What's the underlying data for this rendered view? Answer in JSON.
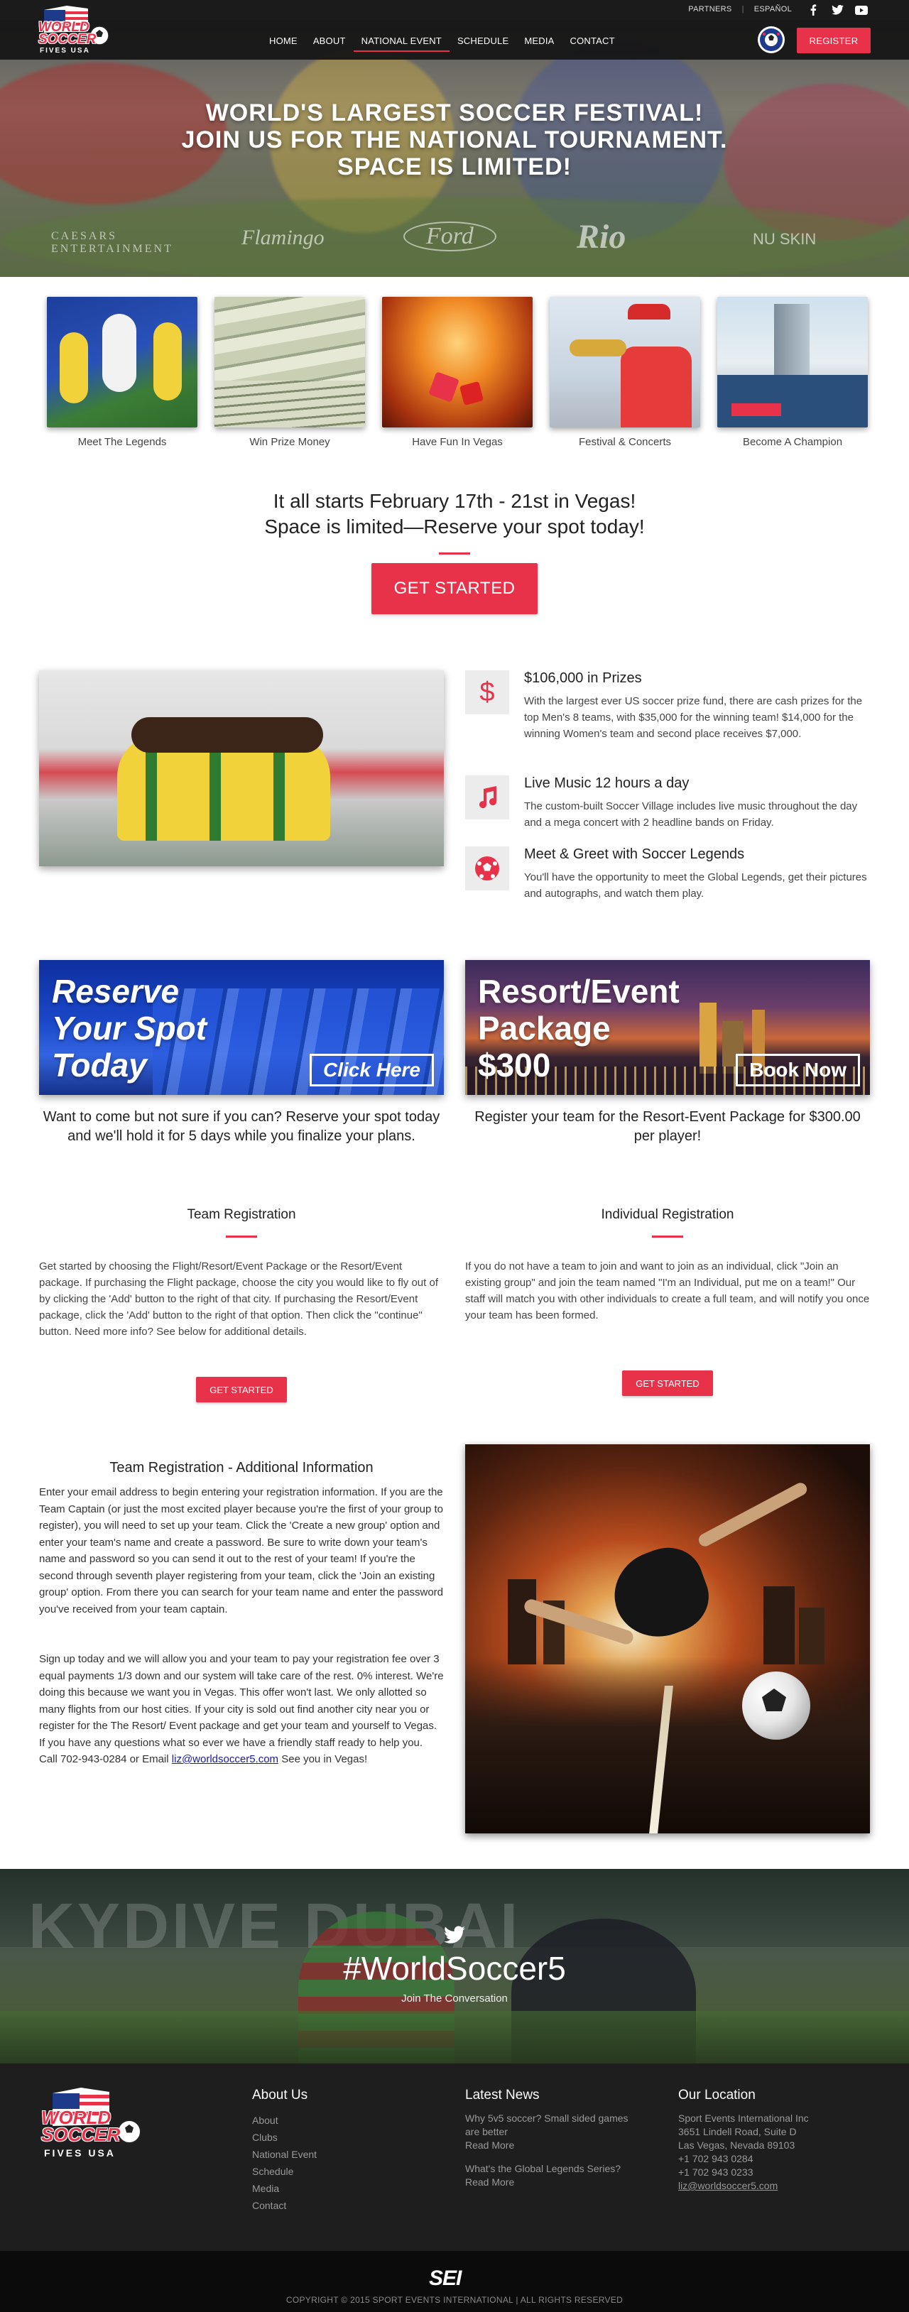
{
  "topbar": {
    "links": [
      "PARTNERS",
      "ESPAÑOL"
    ],
    "social": [
      "facebook-icon",
      "twitter-icon",
      "youtube-icon"
    ]
  },
  "header": {
    "logo_lines": [
      "WORLD",
      "SOCCER",
      "FIVES USA"
    ],
    "nav": [
      "HOME",
      "ABOUT",
      "NATIONAL EVENT",
      "SCHEDULE",
      "MEDIA",
      "CONTACT"
    ],
    "active_nav": "NATIONAL EVENT",
    "register_label": "REGISTER"
  },
  "hero": {
    "line1": "WORLD'S LARGEST SOCCER FESTIVAL!",
    "line2": "JOIN US FOR THE NATIONAL TOURNAMENT.",
    "line3": "SPACE IS LIMITED!",
    "sponsors": [
      "CAESARS ENTERTAINMENT",
      "Flamingo",
      "Ford",
      "Rio",
      "NU SKIN"
    ]
  },
  "features": [
    {
      "caption": "Meet The Legends"
    },
    {
      "caption": "Win Prize Money"
    },
    {
      "caption": "Have Fun In Vegas"
    },
    {
      "caption": "Festival & Concerts"
    },
    {
      "caption": "Become A Champion"
    }
  ],
  "cta": {
    "line1": "It all starts February 17th - 21st in Vegas!",
    "line2": "Space is limited—Reserve your spot today!",
    "button": "GET STARTED"
  },
  "info": [
    {
      "icon": "dollar-icon",
      "title": "$106,000 in Prizes",
      "text": "With the largest ever US soccer prize fund, there are cash prizes for the top Men's 8 teams, with $35,000 for the winning team! $14,000 for the winning Women's team and second place receives $7,000."
    },
    {
      "icon": "music-note-icon",
      "title": "Live Music 12 hours a day",
      "text": "The custom-built Soccer Village includes live music throughout the day and a mega concert with 2 headline bands on Friday."
    },
    {
      "icon": "soccer-ball-icon",
      "title": "Meet & Greet with Soccer Legends",
      "text": "You'll have the opportunity to meet the Global Legends, get their pictures and autographs, and watch them play."
    }
  ],
  "banners": {
    "left": {
      "title_lines": [
        "Reserve",
        "Your Spot",
        "Today"
      ],
      "button": "Click Here",
      "caption": "Want to come but not sure if you can? Reserve your spot today and we'll hold it for 5 days while you finalize your plans."
    },
    "right": {
      "title_lines": [
        "Resort/Event",
        "Package",
        "$300"
      ],
      "button": "Book Now",
      "caption": "Register your team for the Resort-Event Package for $300.00 per player!"
    }
  },
  "registration": {
    "team": {
      "title": "Team Registration",
      "text": "Get started by choosing the Flight/Resort/Event Package or the Resort/Event package. If purchasing the Flight package, choose the city you would like to fly out of by clicking the 'Add' button to the right of that city. If purchasing the Resort/Event package, click the 'Add' button to the right of that option. Then click the \"continue\" button. Need more info? See below for additional details.",
      "button": "GET STARTED"
    },
    "individual": {
      "title": "Individual Registration",
      "text": "If you do not have a team to join and want to join as an individual, click \"Join an existing group\" and join the team named \"I'm an Individual, put me on a team!\" Our staff will match you with other individuals to create a full team, and will notify you once your team has been formed.",
      "button": "GET STARTED"
    }
  },
  "additional": {
    "title": "Team Registration - Additional Information",
    "p1": "Enter your email address to begin entering your registration information. If you are the Team Captain (or just the most excited player because you're the first of your group to register), you will need to set up your team. Click the 'Create a new group' option and enter your team's name and create a password. Be sure to write down your team's name and password so you can send it out to the rest of your team! If you're the second through seventh player registering from your team, click the 'Join an existing group' option. From there you can search for your team name and enter the password you've received from your team captain.",
    "p2": "Sign up today and we will allow you and your team to pay your registration fee over 3 equal payments 1/3 down and our system will take care of the rest. 0% interest. We're doing this because we want you in Vegas. This offer won't last. We only allotted so many flights from our host cities. If your city is sold out find another city near you or register for the The Resort/ Event package and get your team and yourself to Vegas. If you have any questions what so ever we have a friendly staff ready to help you. Call 702-943-0284 or Email",
    "email": "liz@worldsoccer5.com",
    "p2_end": "See you in Vegas!"
  },
  "social_band": {
    "hashtag": "#WorldSoccer5",
    "subtitle": "Join The Conversation"
  },
  "footer": {
    "about_title": "About Us",
    "about_links": [
      "About",
      "Clubs",
      "National Event",
      "Schedule",
      "Media",
      "Contact"
    ],
    "news_title": "Latest News",
    "news": [
      {
        "title": "Why 5v5 soccer? Small sided games are better",
        "more": "Read More"
      },
      {
        "title": "What's the Global Legends Series?",
        "more": "Read More"
      }
    ],
    "location_title": "Our Location",
    "location": [
      "Sport Events International Inc",
      "3651 Lindell Road, Suite D",
      "Las Vegas, Nevada 89103",
      "+1 702 943 0284",
      "+1 702 943 0233"
    ],
    "email": "liz@worldsoccer5.com",
    "brand": "SEI",
    "copyright": "COPYRIGHT © 2015 SPORT EVENTS INTERNATIONAL | ALL RIGHTS RESERVED"
  },
  "colors": {
    "accent": "#e8324a",
    "dark": "#1e1e1e"
  }
}
